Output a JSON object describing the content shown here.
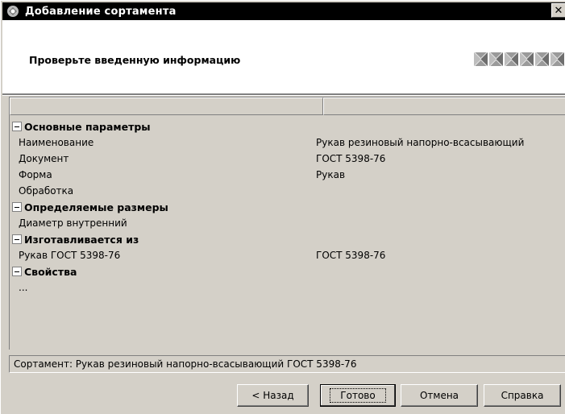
{
  "window": {
    "title": "Добавление сортамента",
    "close_glyph": "✕"
  },
  "header": {
    "instruction": "Проверьте введенную информацию",
    "step_icons": [
      "step-icon",
      "step-icon",
      "step-icon",
      "step-icon",
      "step-icon",
      "step-icon"
    ]
  },
  "grid": {
    "columns": [
      "",
      ""
    ],
    "rows": [
      {
        "type": "group",
        "name": "Основные параметры",
        "value": ""
      },
      {
        "type": "child",
        "name": "Наименование",
        "value": "Рукав резиновый напорно-всасывающий"
      },
      {
        "type": "child",
        "name": "Документ",
        "value": "ГОСТ 5398-76"
      },
      {
        "type": "child",
        "name": "Форма",
        "value": "Рукав"
      },
      {
        "type": "child",
        "name": "Обработка",
        "value": ""
      },
      {
        "type": "group",
        "name": "Определяемые размеры",
        "value": ""
      },
      {
        "type": "child",
        "name": "Диаметр внутренний",
        "value": ""
      },
      {
        "type": "group",
        "name": "Изготавливается из",
        "value": ""
      },
      {
        "type": "child",
        "name": "Рукав ГОСТ 5398-76",
        "value": "ГОСТ 5398-76"
      },
      {
        "type": "group",
        "name": "Свойства",
        "value": ""
      },
      {
        "type": "child",
        "name": "...",
        "value": ""
      }
    ]
  },
  "status": {
    "text": "Сортамент: Рукав резиновый напорно-всасывающий ГОСТ 5398-76"
  },
  "buttons": {
    "back": "< Назад",
    "done": "Готово",
    "cancel": "Отмена",
    "help": "Справка"
  },
  "colors": {
    "titlebar": "#000000",
    "dialog_bg": "#d4d0c8",
    "header_bg": "#ffffff"
  }
}
